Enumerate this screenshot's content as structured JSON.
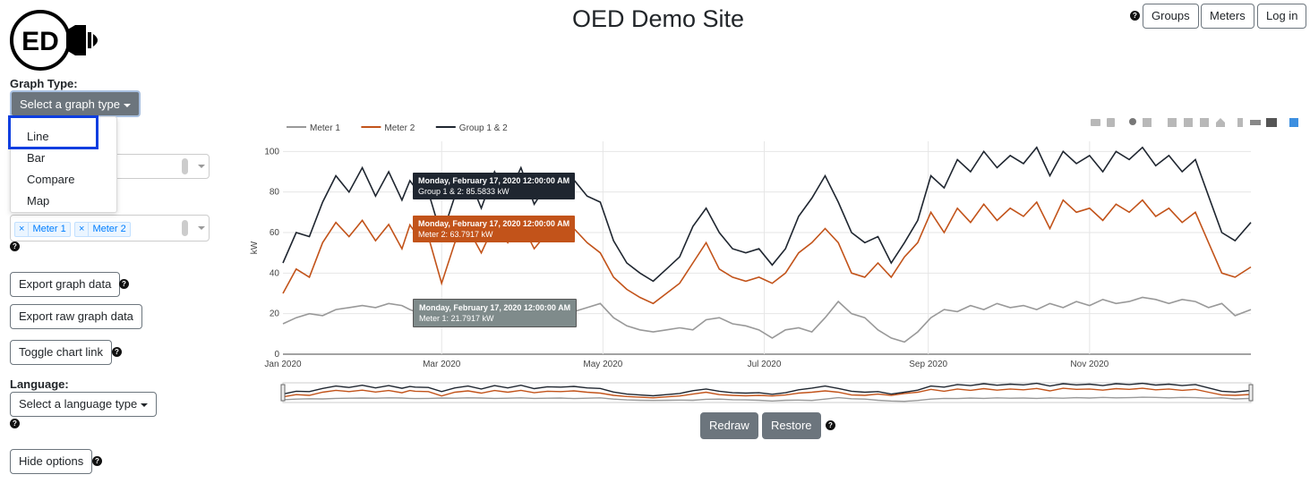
{
  "header": {
    "title": "OED Demo Site",
    "logo_text": "ED",
    "nav": {
      "groups": "Groups",
      "meters": "Meters",
      "login": "Log in"
    }
  },
  "sidebar": {
    "graph_type_label": "Graph Type:",
    "graph_type_button": "Select a graph type",
    "graph_type_options": [
      "Line",
      "Bar",
      "Compare",
      "Map"
    ],
    "selected_meters": [
      "Meter 1",
      "Meter 2"
    ],
    "export_graph_data": "Export graph data",
    "export_raw_graph_data": "Export raw graph data",
    "toggle_chart_link": "Toggle chart link",
    "language_label": "Language:",
    "language_button": "Select a language type",
    "hide_options": "Hide options"
  },
  "controls": {
    "redraw": "Redraw",
    "restore": "Restore"
  },
  "icons": {
    "help": "?",
    "close": "×",
    "clear": "×"
  },
  "colors": {
    "meter1": "#999999",
    "meter2": "#c2531a",
    "group": "#1f2630",
    "highlight": "#0d3ee0",
    "button_dark": "#6c757d"
  },
  "tooltips": [
    {
      "date": "Monday, February 17, 2020 12:00:00 AM",
      "value": "Group 1 & 2: 85.5833 kW",
      "bg": "#1f2630"
    },
    {
      "date": "Monday, February 17, 2020 12:00:00 AM",
      "value": "Meter 2: 63.7917 kW",
      "bg": "#c2531a"
    },
    {
      "date": "Monday, February 17, 2020 12:00:00 AM",
      "value": "Meter 1: 21.7917 kW",
      "bg": "#7f8b8b"
    }
  ],
  "chart_data": {
    "type": "line",
    "title": "",
    "xlabel": "",
    "ylabel": "kW",
    "ylim": [
      0,
      105
    ],
    "yticks": [
      0,
      20,
      40,
      60,
      80,
      100
    ],
    "xlim": [
      0,
      366
    ],
    "xticks": [
      {
        "label": "Jan 2020",
        "x": 0
      },
      {
        "label": "Mar 2020",
        "x": 60
      },
      {
        "label": "May 2020",
        "x": 121
      },
      {
        "label": "Jul 2020",
        "x": 182
      },
      {
        "label": "Sep 2020",
        "x": 244
      },
      {
        "label": "Nov 2020",
        "x": 305
      }
    ],
    "grid": true,
    "legend_position": "top-left",
    "series": [
      {
        "name": "Meter 1",
        "color": "#999999",
        "x": [
          0,
          5,
          10,
          15,
          20,
          25,
          30,
          35,
          40,
          45,
          48,
          50,
          55,
          60,
          65,
          70,
          75,
          80,
          85,
          90,
          95,
          100,
          105,
          110,
          115,
          120,
          125,
          130,
          135,
          140,
          145,
          150,
          155,
          160,
          165,
          170,
          175,
          180,
          185,
          190,
          195,
          200,
          205,
          210,
          215,
          220,
          225,
          230,
          235,
          240,
          245,
          250,
          255,
          260,
          265,
          270,
          275,
          280,
          285,
          290,
          295,
          300,
          305,
          310,
          315,
          320,
          325,
          330,
          335,
          340,
          345,
          350,
          355,
          360,
          366
        ],
        "y": [
          15,
          18,
          20,
          19,
          22,
          23,
          24,
          23,
          25,
          24,
          22,
          21,
          22,
          24,
          23,
          25,
          24,
          22,
          23,
          25,
          22,
          23,
          24,
          21,
          23,
          25,
          18,
          14,
          12,
          11,
          12,
          13,
          12,
          17,
          18,
          15,
          14,
          12,
          8,
          12,
          13,
          11,
          18,
          26,
          20,
          18,
          12,
          8,
          6,
          11,
          18,
          22,
          21,
          24,
          22,
          25,
          23,
          24,
          22,
          25,
          23,
          26,
          24,
          27,
          25,
          26,
          28,
          27,
          25,
          27,
          26,
          23,
          25,
          19,
          22
        ]
      },
      {
        "name": "Meter 2",
        "color": "#c2531a",
        "x": [
          0,
          5,
          10,
          15,
          20,
          25,
          30,
          35,
          40,
          45,
          48,
          50,
          55,
          60,
          65,
          70,
          75,
          80,
          85,
          90,
          95,
          100,
          105,
          110,
          115,
          120,
          125,
          130,
          135,
          140,
          145,
          150,
          155,
          160,
          165,
          170,
          175,
          180,
          185,
          190,
          195,
          200,
          205,
          210,
          215,
          220,
          225,
          230,
          235,
          240,
          245,
          250,
          255,
          260,
          265,
          270,
          275,
          280,
          285,
          290,
          295,
          300,
          305,
          310,
          315,
          320,
          325,
          330,
          335,
          340,
          345,
          350,
          355,
          360,
          366
        ],
        "y": [
          30,
          42,
          38,
          55,
          65,
          58,
          66,
          56,
          64,
          52,
          63.8,
          60,
          58,
          35,
          55,
          62,
          50,
          64,
          55,
          65,
          52,
          60,
          58,
          62,
          55,
          50,
          38,
          32,
          28,
          25,
          30,
          35,
          45,
          55,
          42,
          38,
          36,
          38,
          35,
          40,
          50,
          55,
          62,
          55,
          40,
          38,
          45,
          38,
          48,
          55,
          70,
          60,
          72,
          65,
          74,
          66,
          72,
          68,
          75,
          62,
          76,
          70,
          72,
          66,
          74,
          70,
          76,
          68,
          72,
          65,
          70,
          55,
          40,
          38,
          43
        ]
      },
      {
        "name": "Group 1 & 2",
        "color": "#1f2630",
        "x": [
          0,
          5,
          10,
          15,
          20,
          25,
          30,
          35,
          40,
          45,
          48,
          50,
          55,
          60,
          65,
          70,
          75,
          80,
          85,
          90,
          95,
          100,
          105,
          110,
          115,
          120,
          125,
          130,
          135,
          140,
          145,
          150,
          155,
          160,
          165,
          170,
          175,
          180,
          185,
          190,
          195,
          200,
          205,
          210,
          215,
          220,
          225,
          230,
          235,
          240,
          245,
          250,
          255,
          260,
          265,
          270,
          275,
          280,
          285,
          290,
          295,
          300,
          305,
          310,
          315,
          320,
          325,
          330,
          335,
          340,
          345,
          350,
          355,
          360,
          366
        ],
        "y": [
          45,
          60,
          58,
          75,
          88,
          80,
          92,
          78,
          90,
          76,
          85.6,
          82,
          80,
          58,
          78,
          88,
          72,
          90,
          78,
          92,
          74,
          84,
          82,
          86,
          78,
          75,
          56,
          45,
          40,
          36,
          42,
          48,
          63,
          72,
          60,
          52,
          50,
          52,
          44,
          52,
          68,
          77,
          88,
          75,
          60,
          55,
          58,
          45,
          55,
          66,
          88,
          82,
          96,
          90,
          100,
          92,
          98,
          94,
          102,
          88,
          100,
          94,
          98,
          90,
          100,
          96,
          102,
          93,
          98,
          90,
          96,
          78,
          60,
          56,
          65
        ]
      }
    ]
  }
}
